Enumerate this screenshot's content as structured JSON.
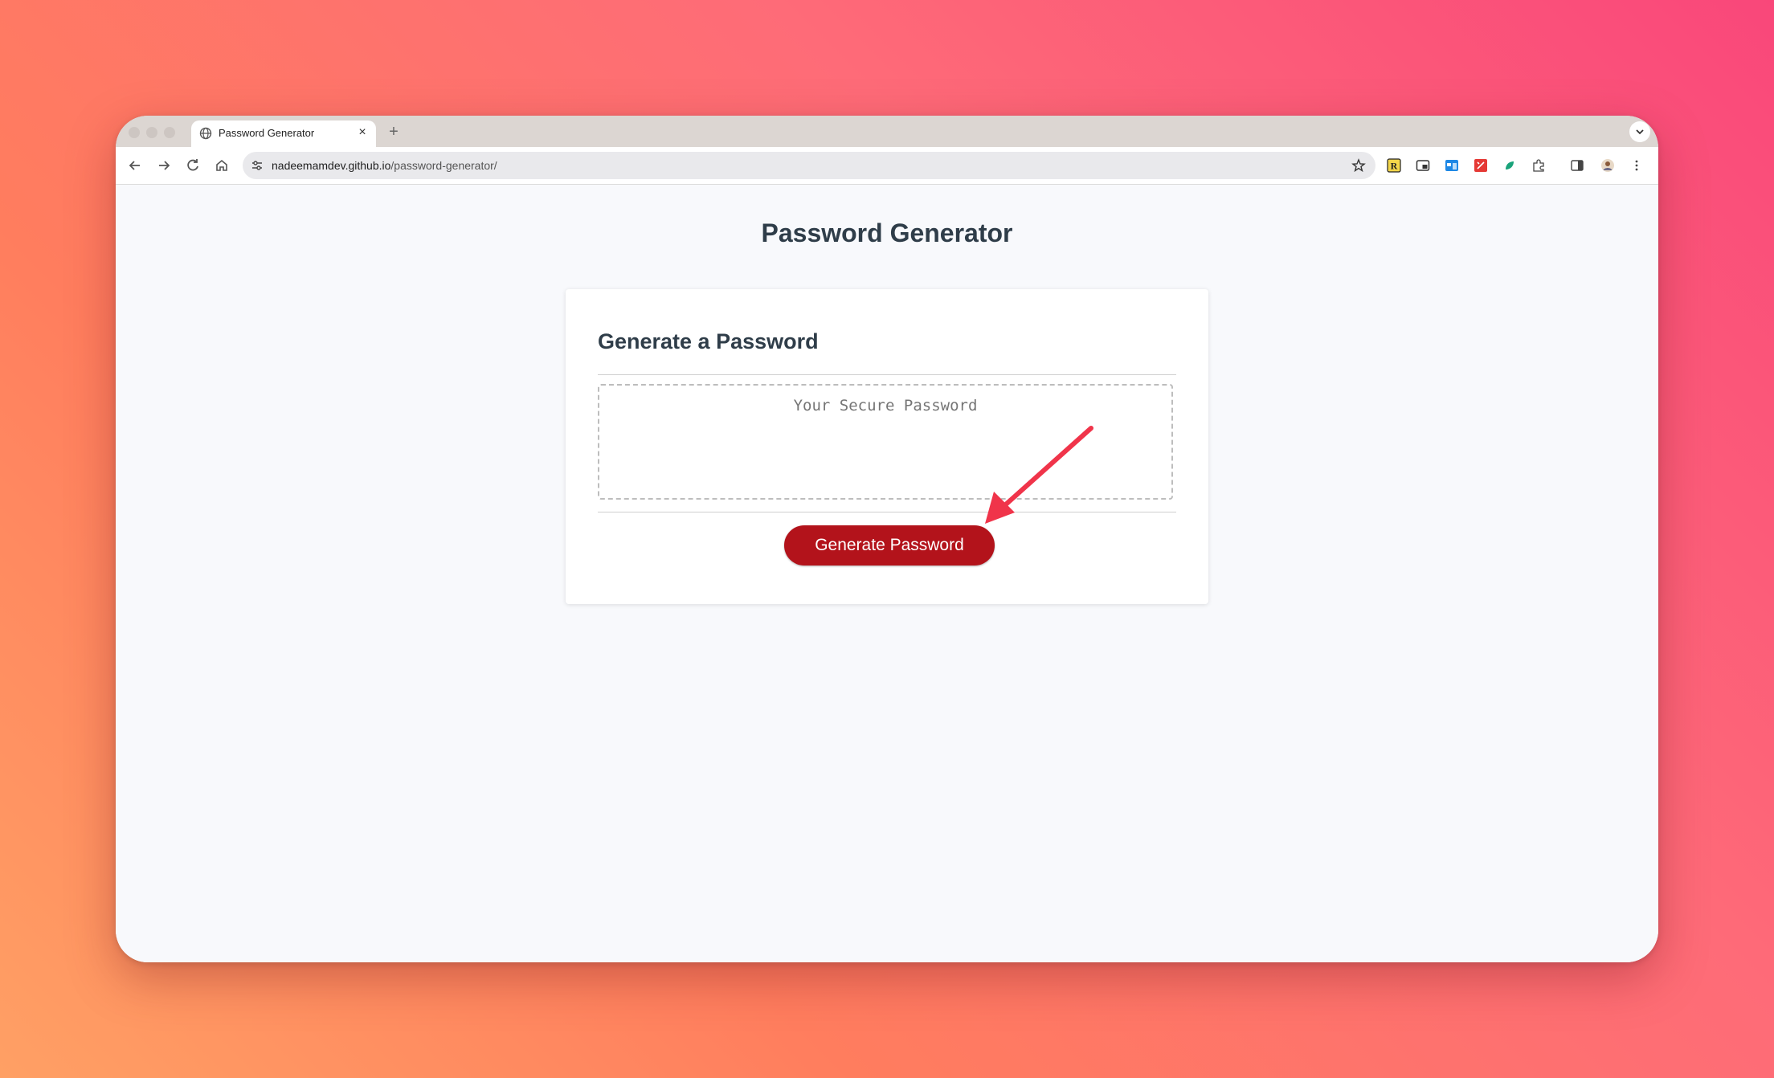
{
  "browser": {
    "tab": {
      "title": "Password Generator",
      "close_label": "×"
    },
    "new_tab_label": "+",
    "address": {
      "host": "nadeemamdev.github.io",
      "path": "/password-generator/"
    },
    "extension_icons": [
      "readwise-icon",
      "picture-in-picture-icon",
      "window-icon",
      "pdf-icon",
      "leaf-icon",
      "puzzle-icon",
      "sidepanel-icon",
      "profile-avatar-icon",
      "menu-icon"
    ]
  },
  "page": {
    "title": "Password Generator",
    "card": {
      "header": "Generate a Password",
      "password_placeholder": "Your Secure Password",
      "button_label": "Generate Password"
    }
  },
  "colors": {
    "button": "#b3131b",
    "heading": "#2f3d49",
    "annotation_arrow": "#f0344a"
  }
}
